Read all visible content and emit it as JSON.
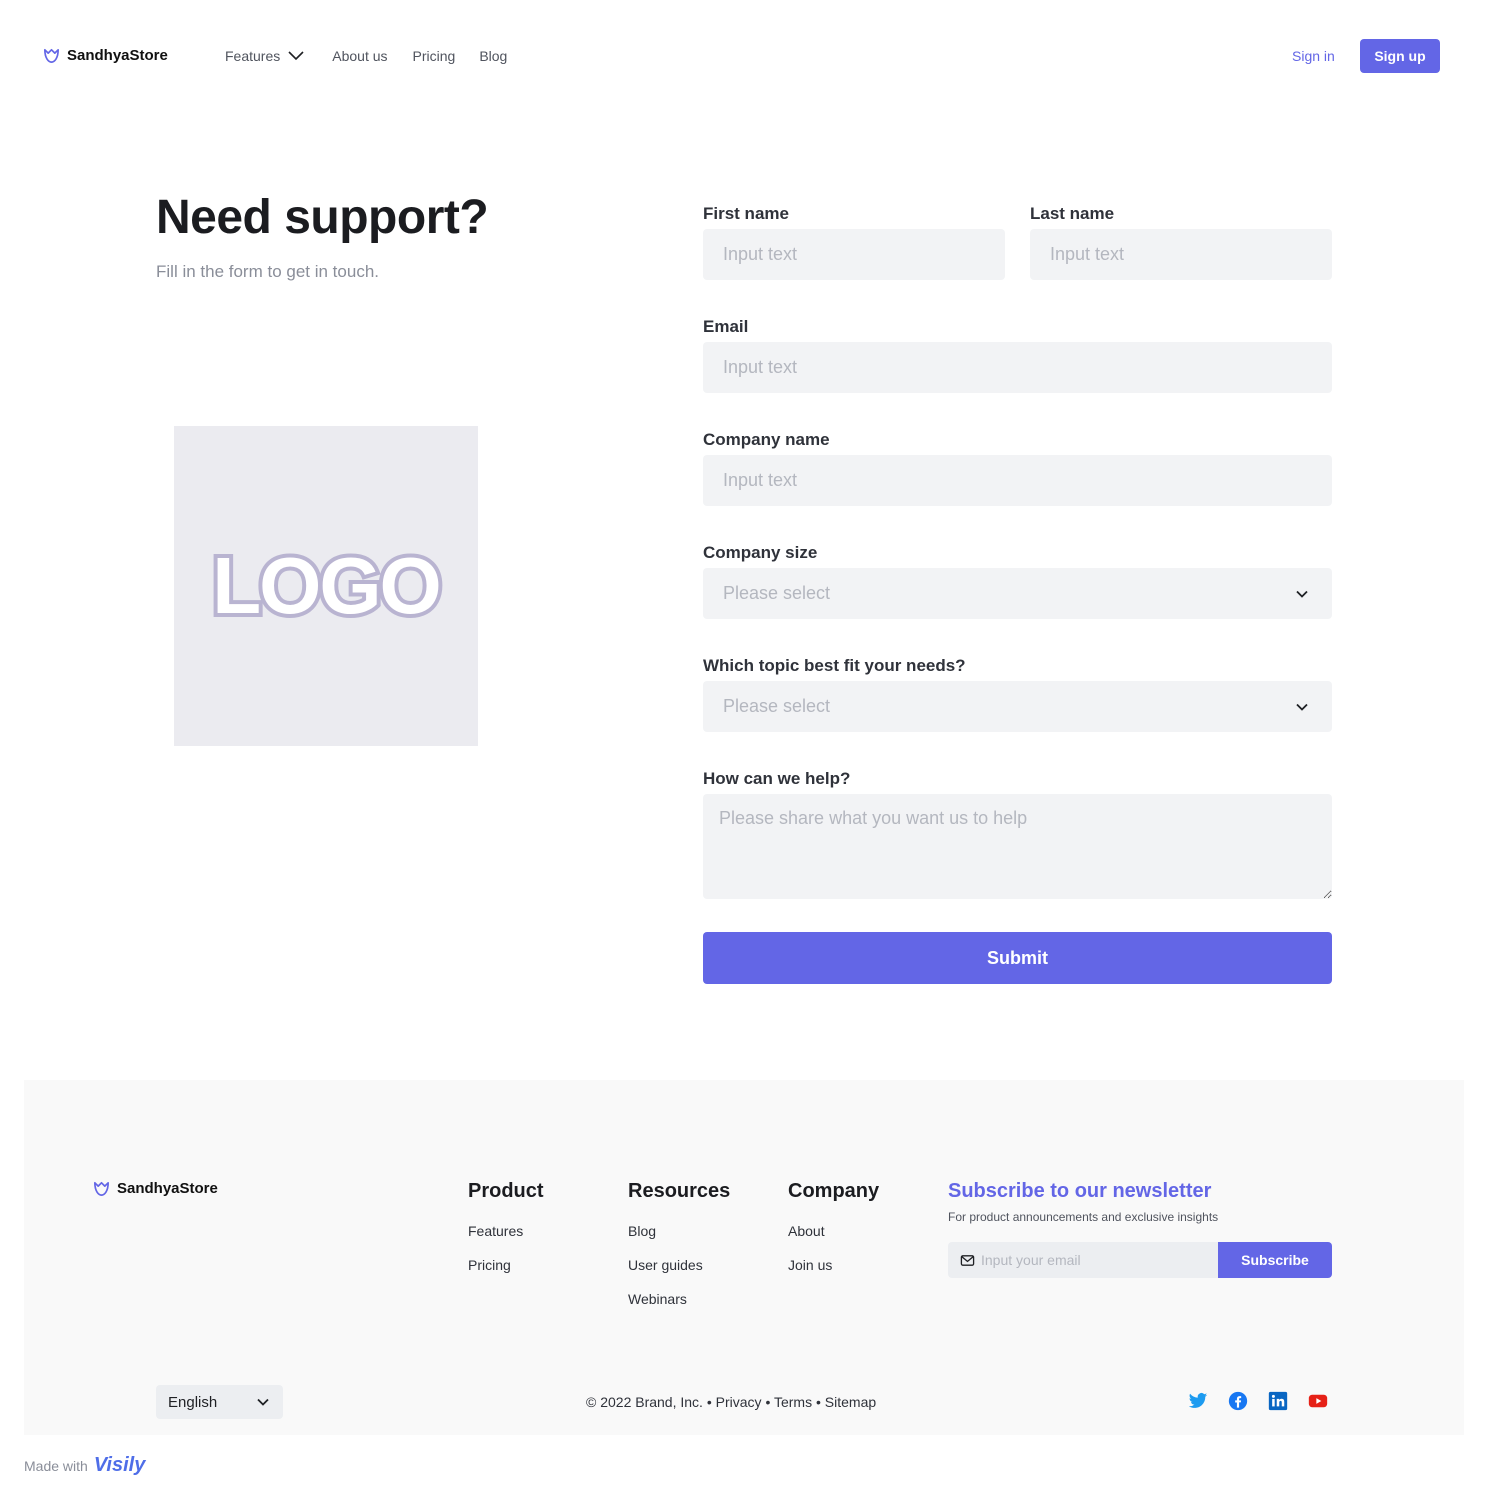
{
  "header": {
    "brand": "SandhyaStore",
    "nav": [
      "Features",
      "About us",
      "Pricing",
      "Blog"
    ],
    "signin": "Sign in",
    "signup": "Sign up"
  },
  "hero": {
    "title": "Need support?",
    "subtitle": "Fill in the form to get in touch.",
    "logo_text": "LOGO"
  },
  "form": {
    "first_name": {
      "label": "First name",
      "placeholder": "Input text"
    },
    "last_name": {
      "label": "Last name",
      "placeholder": "Input text"
    },
    "email": {
      "label": "Email",
      "placeholder": "Input text"
    },
    "company_name": {
      "label": "Company name",
      "placeholder": "Input text"
    },
    "company_size": {
      "label": "Company size",
      "value": "Please select"
    },
    "topic": {
      "label": "Which topic best fit your needs?",
      "value": "Please select"
    },
    "help": {
      "label": "How can we help?",
      "placeholder": "Please share what you want us to help"
    },
    "submit": "Submit"
  },
  "footer": {
    "brand": "SandhyaStore",
    "product": {
      "title": "Product",
      "links": [
        "Features",
        "Pricing"
      ]
    },
    "resources": {
      "title": "Resources",
      "links": [
        "Blog",
        "User guides",
        "Webinars"
      ]
    },
    "company": {
      "title": "Company",
      "links": [
        "About",
        "Join us"
      ]
    },
    "newsletter": {
      "title": "Subscribe to our newsletter",
      "desc": "For product announcements and exclusive insights",
      "placeholder": "Input your email",
      "button": "Subscribe"
    },
    "language": "English",
    "copyright": "© 2022 Brand, Inc.",
    "legal": [
      "Privacy",
      "Terms",
      "Sitemap"
    ],
    "separator": "•",
    "social": [
      "twitter-icon",
      "facebook-icon",
      "linkedin-icon",
      "youtube-icon"
    ]
  },
  "made_with": {
    "text": "Made with",
    "brand": "Visily"
  },
  "colors": {
    "accent": "#6366e6",
    "input_bg": "#f2f3f5",
    "footer_bg": "#f9f9f9"
  }
}
